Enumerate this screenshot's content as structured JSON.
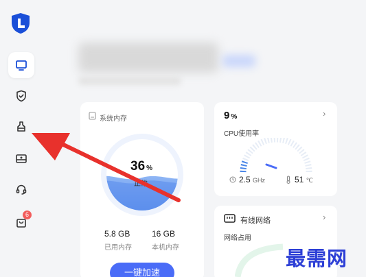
{
  "sidebar": {
    "logo": "shield-logo-icon",
    "items": [
      {
        "icon": "monitor-icon",
        "active": true
      },
      {
        "icon": "shield-check-icon",
        "active": false
      },
      {
        "icon": "broom-clean-icon",
        "active": false
      },
      {
        "icon": "toolbox-icon",
        "active": false
      },
      {
        "icon": "headset-icon",
        "active": false
      },
      {
        "icon": "bag-icon",
        "active": false,
        "badge": "6"
      }
    ]
  },
  "memory": {
    "title": "系统内存",
    "percent": "36",
    "percent_unit": "%",
    "status": "正常",
    "used_value": "5.8 GB",
    "used_label": "已用内存",
    "total_value": "16 GB",
    "total_label": "本机内存",
    "button_label": "一键加速"
  },
  "cpu": {
    "percent": "9",
    "percent_unit": "%",
    "label": "CPU使用率",
    "freq_value": "2.5",
    "freq_unit": "GHz",
    "temp_value": "51",
    "temp_unit": "℃"
  },
  "network": {
    "title": "有线网络",
    "label": "网络占用"
  },
  "watermark": "最需网",
  "colors": {
    "accent": "#4a6cf7",
    "arrow": "#e8312c",
    "badge": "#f25c5c",
    "sidebar_bg": "#f4f5f7"
  }
}
